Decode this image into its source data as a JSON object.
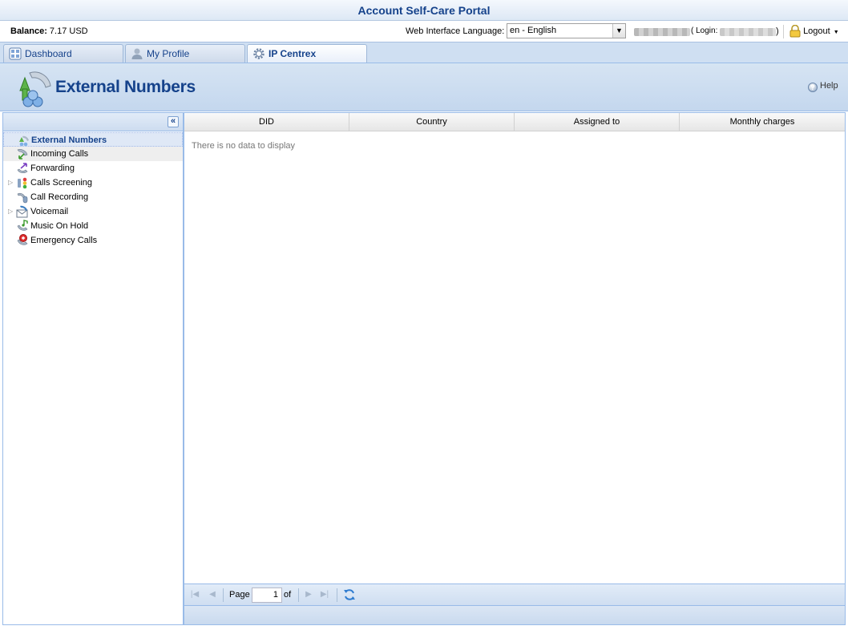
{
  "app": {
    "title": "Account Self-Care Portal"
  },
  "account": {
    "balance_label": "Balance:",
    "balance_value": "7.17 USD",
    "language_label": "Web Interface Language:",
    "language_value": "en - English",
    "login_label": "( Login:",
    "login_close": ")",
    "logout_label": "Logout"
  },
  "tabs": [
    {
      "label": "Dashboard",
      "icon": "dashboard-icon",
      "active": false
    },
    {
      "label": "My Profile",
      "icon": "user-icon",
      "active": false
    },
    {
      "label": "IP Centrex",
      "icon": "gear-icon",
      "active": true
    }
  ],
  "page": {
    "title": "External Numbers",
    "help_label": "Help",
    "icon": "external-numbers-icon"
  },
  "sidebar": {
    "items": [
      {
        "label": "External Numbers",
        "icon": "external-numbers-icon",
        "selected": true,
        "expandable": false
      },
      {
        "label": "Incoming Calls",
        "icon": "incoming-calls-icon",
        "selected": false,
        "expandable": false
      },
      {
        "label": "Forwarding",
        "icon": "forwarding-icon",
        "selected": false,
        "expandable": false
      },
      {
        "label": "Calls Screening",
        "icon": "calls-screening-icon",
        "selected": false,
        "expandable": true
      },
      {
        "label": "Call Recording",
        "icon": "call-recording-icon",
        "selected": false,
        "expandable": false
      },
      {
        "label": "Voicemail",
        "icon": "voicemail-icon",
        "selected": false,
        "expandable": true
      },
      {
        "label": "Music On Hold",
        "icon": "music-on-hold-icon",
        "selected": false,
        "expandable": false
      },
      {
        "label": "Emergency Calls",
        "icon": "emergency-calls-icon",
        "selected": false,
        "expandable": false
      }
    ]
  },
  "grid": {
    "columns": [
      "DID",
      "Country",
      "Assigned to",
      "Monthly charges"
    ],
    "empty_message": "There is no data to display"
  },
  "pager": {
    "page_label": "Page",
    "page_value": "1",
    "of_label": "of"
  },
  "colors": {
    "accent": "#15428b",
    "border": "#99bbe8",
    "panel_bg": "#d6e4f3"
  }
}
